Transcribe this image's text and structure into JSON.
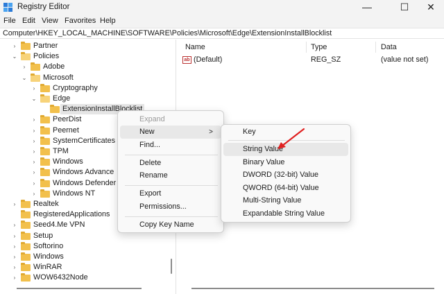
{
  "window": {
    "title": "Registry Editor",
    "controls": {
      "minimize": "—",
      "maximize": "☐",
      "close": "✕"
    }
  },
  "menubar": [
    "File",
    "Edit",
    "View",
    "Favorites",
    "Help"
  ],
  "address": "Computer\\HKEY_LOCAL_MACHINE\\SOFTWARE\\Policies\\Microsoft\\Edge\\ExtensionInstallBlocklist",
  "tree": [
    {
      "label": "Partner",
      "chev": ">"
    },
    {
      "label": "Policies",
      "chev": "v"
    },
    {
      "label": "Adobe",
      "chev": ">"
    },
    {
      "label": "Microsoft",
      "chev": "v"
    },
    {
      "label": "Cryptography",
      "chev": ">"
    },
    {
      "label": "Edge",
      "chev": "v"
    },
    {
      "label": "ExtensionInstallBlocklist",
      "chev": ""
    },
    {
      "label": "PeerDist",
      "chev": ">"
    },
    {
      "label": "Peernet",
      "chev": ">"
    },
    {
      "label": "SystemCertificates",
      "chev": ">"
    },
    {
      "label": "TPM",
      "chev": ">"
    },
    {
      "label": "Windows",
      "chev": ">"
    },
    {
      "label": "Windows Advance",
      "chev": ">"
    },
    {
      "label": "Windows Defender",
      "chev": ">"
    },
    {
      "label": "Windows NT",
      "chev": ">"
    },
    {
      "label": "Realtek",
      "chev": ">"
    },
    {
      "label": "RegisteredApplications",
      "chev": ""
    },
    {
      "label": "Seed4.Me VPN",
      "chev": ">"
    },
    {
      "label": "Setup",
      "chev": ">"
    },
    {
      "label": "Softorino",
      "chev": ">"
    },
    {
      "label": "Windows",
      "chev": ">"
    },
    {
      "label": "WinRAR",
      "chev": ">"
    },
    {
      "label": "WOW6432Node",
      "chev": ">"
    }
  ],
  "columns": {
    "name": "Name",
    "type": "Type",
    "data": "Data"
  },
  "values": [
    {
      "icon": "ab",
      "name": "(Default)",
      "type": "REG_SZ",
      "data": "(value not set)"
    }
  ],
  "context_menu": {
    "expand": "Expand",
    "new": "New",
    "new_arrow": ">",
    "find": "Find...",
    "delete": "Delete",
    "rename": "Rename",
    "export": "Export",
    "permissions": "Permissions...",
    "copy_key_name": "Copy Key Name"
  },
  "submenu": {
    "key": "Key",
    "string_value": "String Value",
    "binary_value": "Binary Value",
    "dword_value": "DWORD (32-bit) Value",
    "qword_value": "QWORD (64-bit) Value",
    "multi_string_value": "Multi-String Value",
    "expandable_string_value": "Expandable String Value"
  },
  "colors": {
    "folder": "#f2c04c",
    "arrow": "#e02020",
    "hover": "#e8e8e8"
  }
}
